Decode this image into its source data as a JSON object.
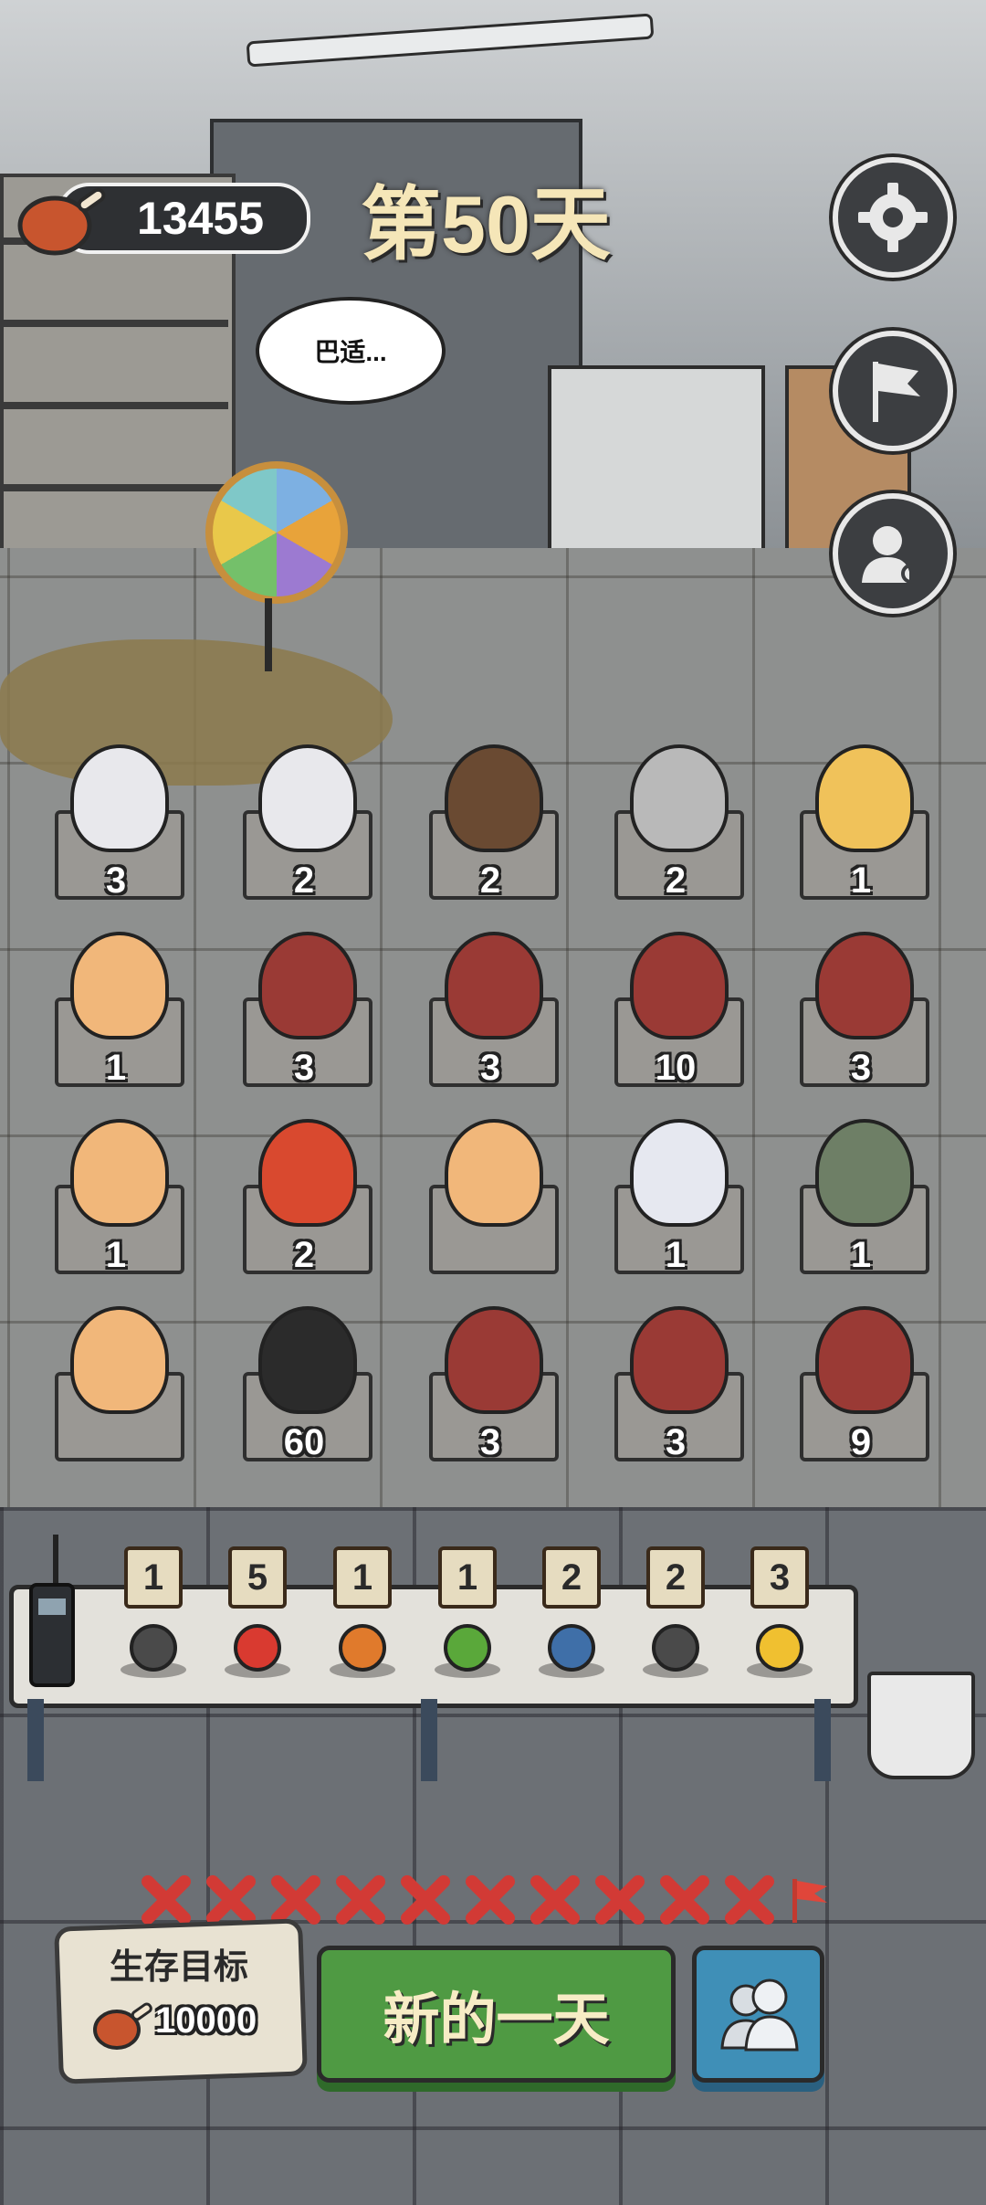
{
  "hud": {
    "currency": "13455",
    "currency_icon": "meat-icon",
    "day_title": "第50天",
    "speech_bubble": "巴适..."
  },
  "side_buttons": [
    {
      "name": "settings-button",
      "icon": "gear-icon"
    },
    {
      "name": "flag-button",
      "icon": "flag-icon"
    },
    {
      "name": "profile-search-button",
      "icon": "user-search-icon"
    }
  ],
  "grid": {
    "rows": [
      [
        {
          "character": "white-haired-girl",
          "count": "3",
          "color": "#e8e8ec"
        },
        {
          "character": "white-haired-girl",
          "count": "2",
          "color": "#e8e8ec"
        },
        {
          "character": "bearded-man",
          "count": "2",
          "color": "#6a4a32"
        },
        {
          "character": "old-miner",
          "count": "2",
          "color": "#b9b9b9"
        },
        {
          "character": "blonde-girl",
          "count": "1",
          "color": "#f0c25a"
        }
      ],
      [
        {
          "character": "curly-haired-girl",
          "count": "1",
          "color": "#f1b77a"
        },
        {
          "character": "red-dragon",
          "count": "3",
          "color": "#9a3a35"
        },
        {
          "character": "red-dragon",
          "count": "3",
          "color": "#9a3a35"
        },
        {
          "character": "red-dragon",
          "count": "10",
          "color": "#9a3a35"
        },
        {
          "character": "red-dragon",
          "count": "3",
          "color": "#9a3a35"
        }
      ],
      [
        {
          "character": "curly-haired-girl",
          "count": "1",
          "color": "#f1b77a"
        },
        {
          "character": "rainbow-clown",
          "count": "2",
          "color": "#d9492f"
        },
        {
          "character": "curly-haired-girl",
          "count": "",
          "color": "#f1b77a"
        },
        {
          "character": "ghost",
          "count": "1",
          "color": "#e6e8f0"
        },
        {
          "character": "robot",
          "count": "1",
          "color": "#6e7f66"
        }
      ],
      [
        {
          "character": "curly-haired-girl",
          "count": "",
          "color": "#f1b77a"
        },
        {
          "character": "school-boy",
          "count": "60",
          "color": "#2b2b2b"
        },
        {
          "character": "red-dragon",
          "count": "3",
          "color": "#9a3a35"
        },
        {
          "character": "red-dragon",
          "count": "3",
          "color": "#9a3a35"
        },
        {
          "character": "red-dragon",
          "count": "9",
          "color": "#9a3a35"
        }
      ]
    ]
  },
  "inventory": {
    "radio_icon": "walkie-talkie-icon",
    "items": [
      {
        "icon": "boot-icon",
        "count": "1",
        "color": "#4a4a4a"
      },
      {
        "icon": "red-crystal-icon",
        "count": "5",
        "color": "#d93a30"
      },
      {
        "icon": "basketball-icon",
        "count": "1",
        "color": "#e07a2c"
      },
      {
        "icon": "herb-leaf-icon",
        "count": "1",
        "color": "#5aa83a"
      },
      {
        "icon": "backpack-icon",
        "count": "2",
        "color": "#3f6fa8"
      },
      {
        "icon": "knife-icon",
        "count": "2",
        "color": "#4a4a4a"
      },
      {
        "icon": "gold-ore-icon",
        "count": "3",
        "color": "#f0c030"
      }
    ]
  },
  "progress": {
    "marks": [
      "x",
      "x",
      "x",
      "x",
      "x",
      "x",
      "x",
      "x",
      "x",
      "x"
    ],
    "end_icon": "red-flag-icon"
  },
  "goal": {
    "title": "生存目标",
    "value": "10000"
  },
  "buttons": {
    "new_day": "新的一天",
    "people_icon": "people-icon"
  },
  "colors": {
    "green_button": "#4f9a43",
    "blue_button": "#3f8fb7",
    "x_mark": "#d23a35",
    "day_title": "#f5e6b8"
  }
}
